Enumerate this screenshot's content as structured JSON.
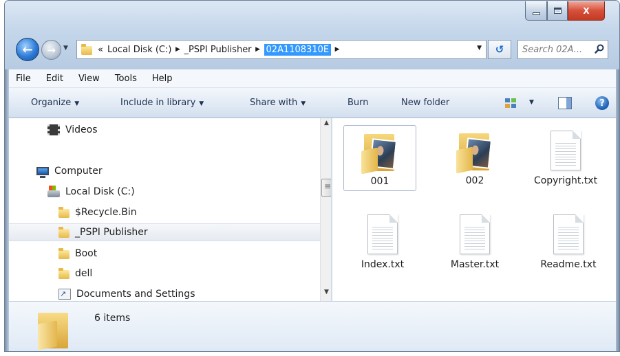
{
  "window": {
    "minimize_glyph": "",
    "close_glyph": "X"
  },
  "nav": {
    "back_glyph": "←",
    "forward_glyph": "→"
  },
  "address": {
    "overflow": "«",
    "crumbs": [
      "Local Disk (C:)",
      "_PSPI Publisher",
      "02A1108310E"
    ],
    "separator": "▶"
  },
  "search": {
    "placeholder": "Search 02A..."
  },
  "menu": {
    "items": [
      "File",
      "Edit",
      "View",
      "Tools",
      "Help"
    ]
  },
  "commands": {
    "organize": "Organize",
    "include_in_library": "Include in library",
    "share_with": "Share with",
    "burn": "Burn",
    "new_folder": "New folder",
    "help_glyph": "?"
  },
  "tree": {
    "items": [
      {
        "label": "Videos",
        "icon": "film-icon"
      },
      {
        "label": "Computer",
        "icon": "computer-icon"
      },
      {
        "label": "Local Disk (C:)",
        "icon": "disk-icon"
      },
      {
        "label": "$Recycle.Bin",
        "icon": "folder-icon"
      },
      {
        "label": "_PSPI Publisher",
        "icon": "folder-icon",
        "selected": true
      },
      {
        "label": "Boot",
        "icon": "folder-icon"
      },
      {
        "label": "dell",
        "icon": "folder-icon"
      },
      {
        "label": "Documents and Settings",
        "icon": "shortcut-folder-icon"
      }
    ]
  },
  "files": {
    "items": [
      {
        "name": "001",
        "type": "folder"
      },
      {
        "name": "002",
        "type": "folder"
      },
      {
        "name": "Copyright.txt",
        "type": "text"
      },
      {
        "name": "Index.txt",
        "type": "text"
      },
      {
        "name": "Master.txt",
        "type": "text"
      },
      {
        "name": "Readme.txt",
        "type": "text"
      }
    ]
  },
  "details": {
    "count": "6 items"
  },
  "colors": {
    "selection": "#3399ff",
    "frame": "#c9d9ea",
    "close_button": "#d6503a"
  }
}
